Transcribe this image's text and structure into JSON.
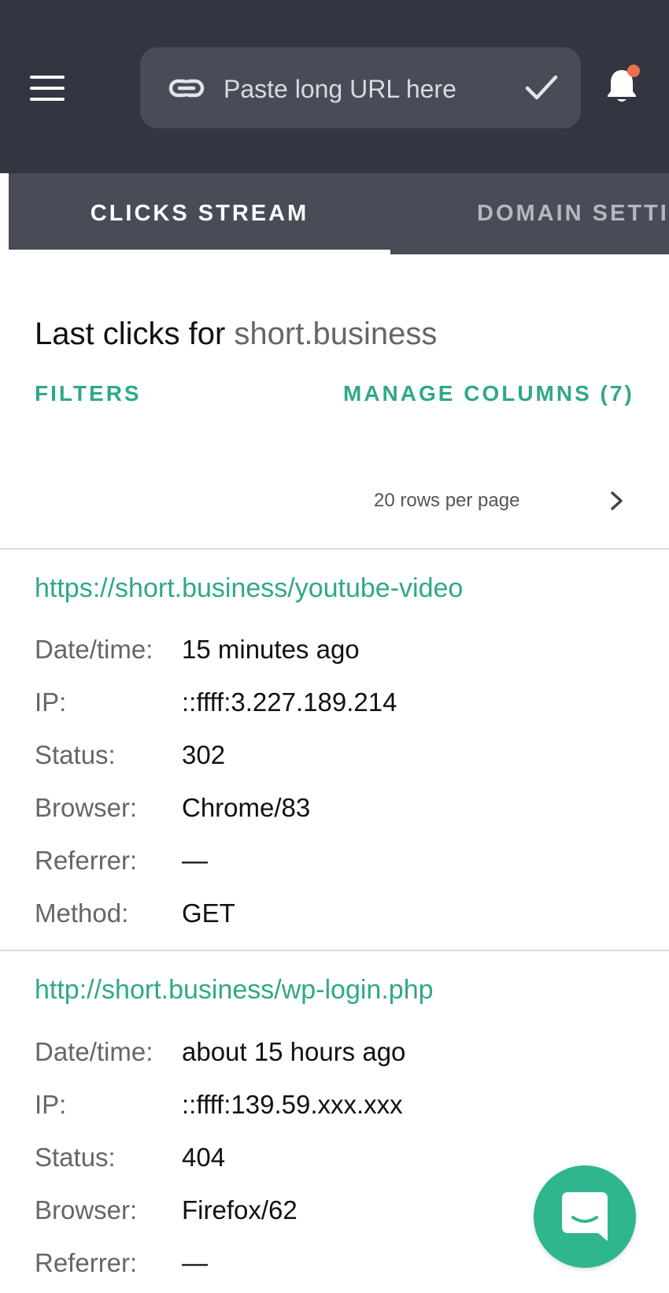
{
  "header": {
    "url_placeholder": "Paste long URL here"
  },
  "tabs": [
    {
      "label": "CLICKS STREAM",
      "active": true
    },
    {
      "label": "DOMAIN SETTI",
      "active": false
    }
  ],
  "main": {
    "heading_prefix": "Last clicks for",
    "heading_domain": "short.business",
    "filters_label": "FILTERS",
    "manage_columns_label": "MANAGE COLUMNS (7)",
    "rows_per_page": "20 rows per page"
  },
  "clicks": [
    {
      "url": "https://short.business/youtube-video",
      "fields": [
        {
          "label": "Date/time:",
          "value": "15 minutes ago"
        },
        {
          "label": "IP:",
          "value": "::ffff:3.227.189.214"
        },
        {
          "label": "Status:",
          "value": "302"
        },
        {
          "label": "Browser:",
          "value": "Chrome/83"
        },
        {
          "label": "Referrer:",
          "value": "—"
        },
        {
          "label": "Method:",
          "value": "GET"
        }
      ]
    },
    {
      "url": "http://short.business/wp-login.php",
      "fields": [
        {
          "label": "Date/time:",
          "value": "about 15 hours ago"
        },
        {
          "label": "IP:",
          "value": "::ffff:139.59.xxx.xxx"
        },
        {
          "label": "Status:",
          "value": "404"
        },
        {
          "label": "Browser:",
          "value": "Firefox/62"
        },
        {
          "label": "Referrer:",
          "value": "—"
        }
      ]
    }
  ],
  "colors": {
    "accent": "#2fa889",
    "topbar": "#323641",
    "tabbar": "#474c57",
    "notification_dot": "#f0704a",
    "chat_button": "#2fb68f"
  },
  "icons": [
    "menu-icon",
    "link-icon",
    "check-icon",
    "bell-icon",
    "chevron-right-icon",
    "chat-icon"
  ]
}
